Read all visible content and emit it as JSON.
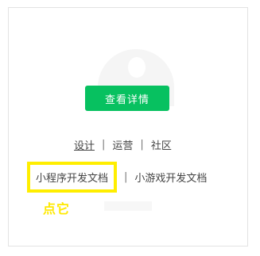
{
  "main": {
    "view_details_label": "查看详情",
    "links": [
      {
        "label": "设计"
      },
      {
        "label": "运营"
      },
      {
        "label": "社区"
      }
    ],
    "separator": "|",
    "docs": [
      {
        "label": "小程序开发文档"
      },
      {
        "label": "小游戏开发文档"
      }
    ],
    "annotation": "点它"
  },
  "colors": {
    "accent": "#07c160",
    "highlight": "#ffee00",
    "annotation": "#ffe900"
  }
}
